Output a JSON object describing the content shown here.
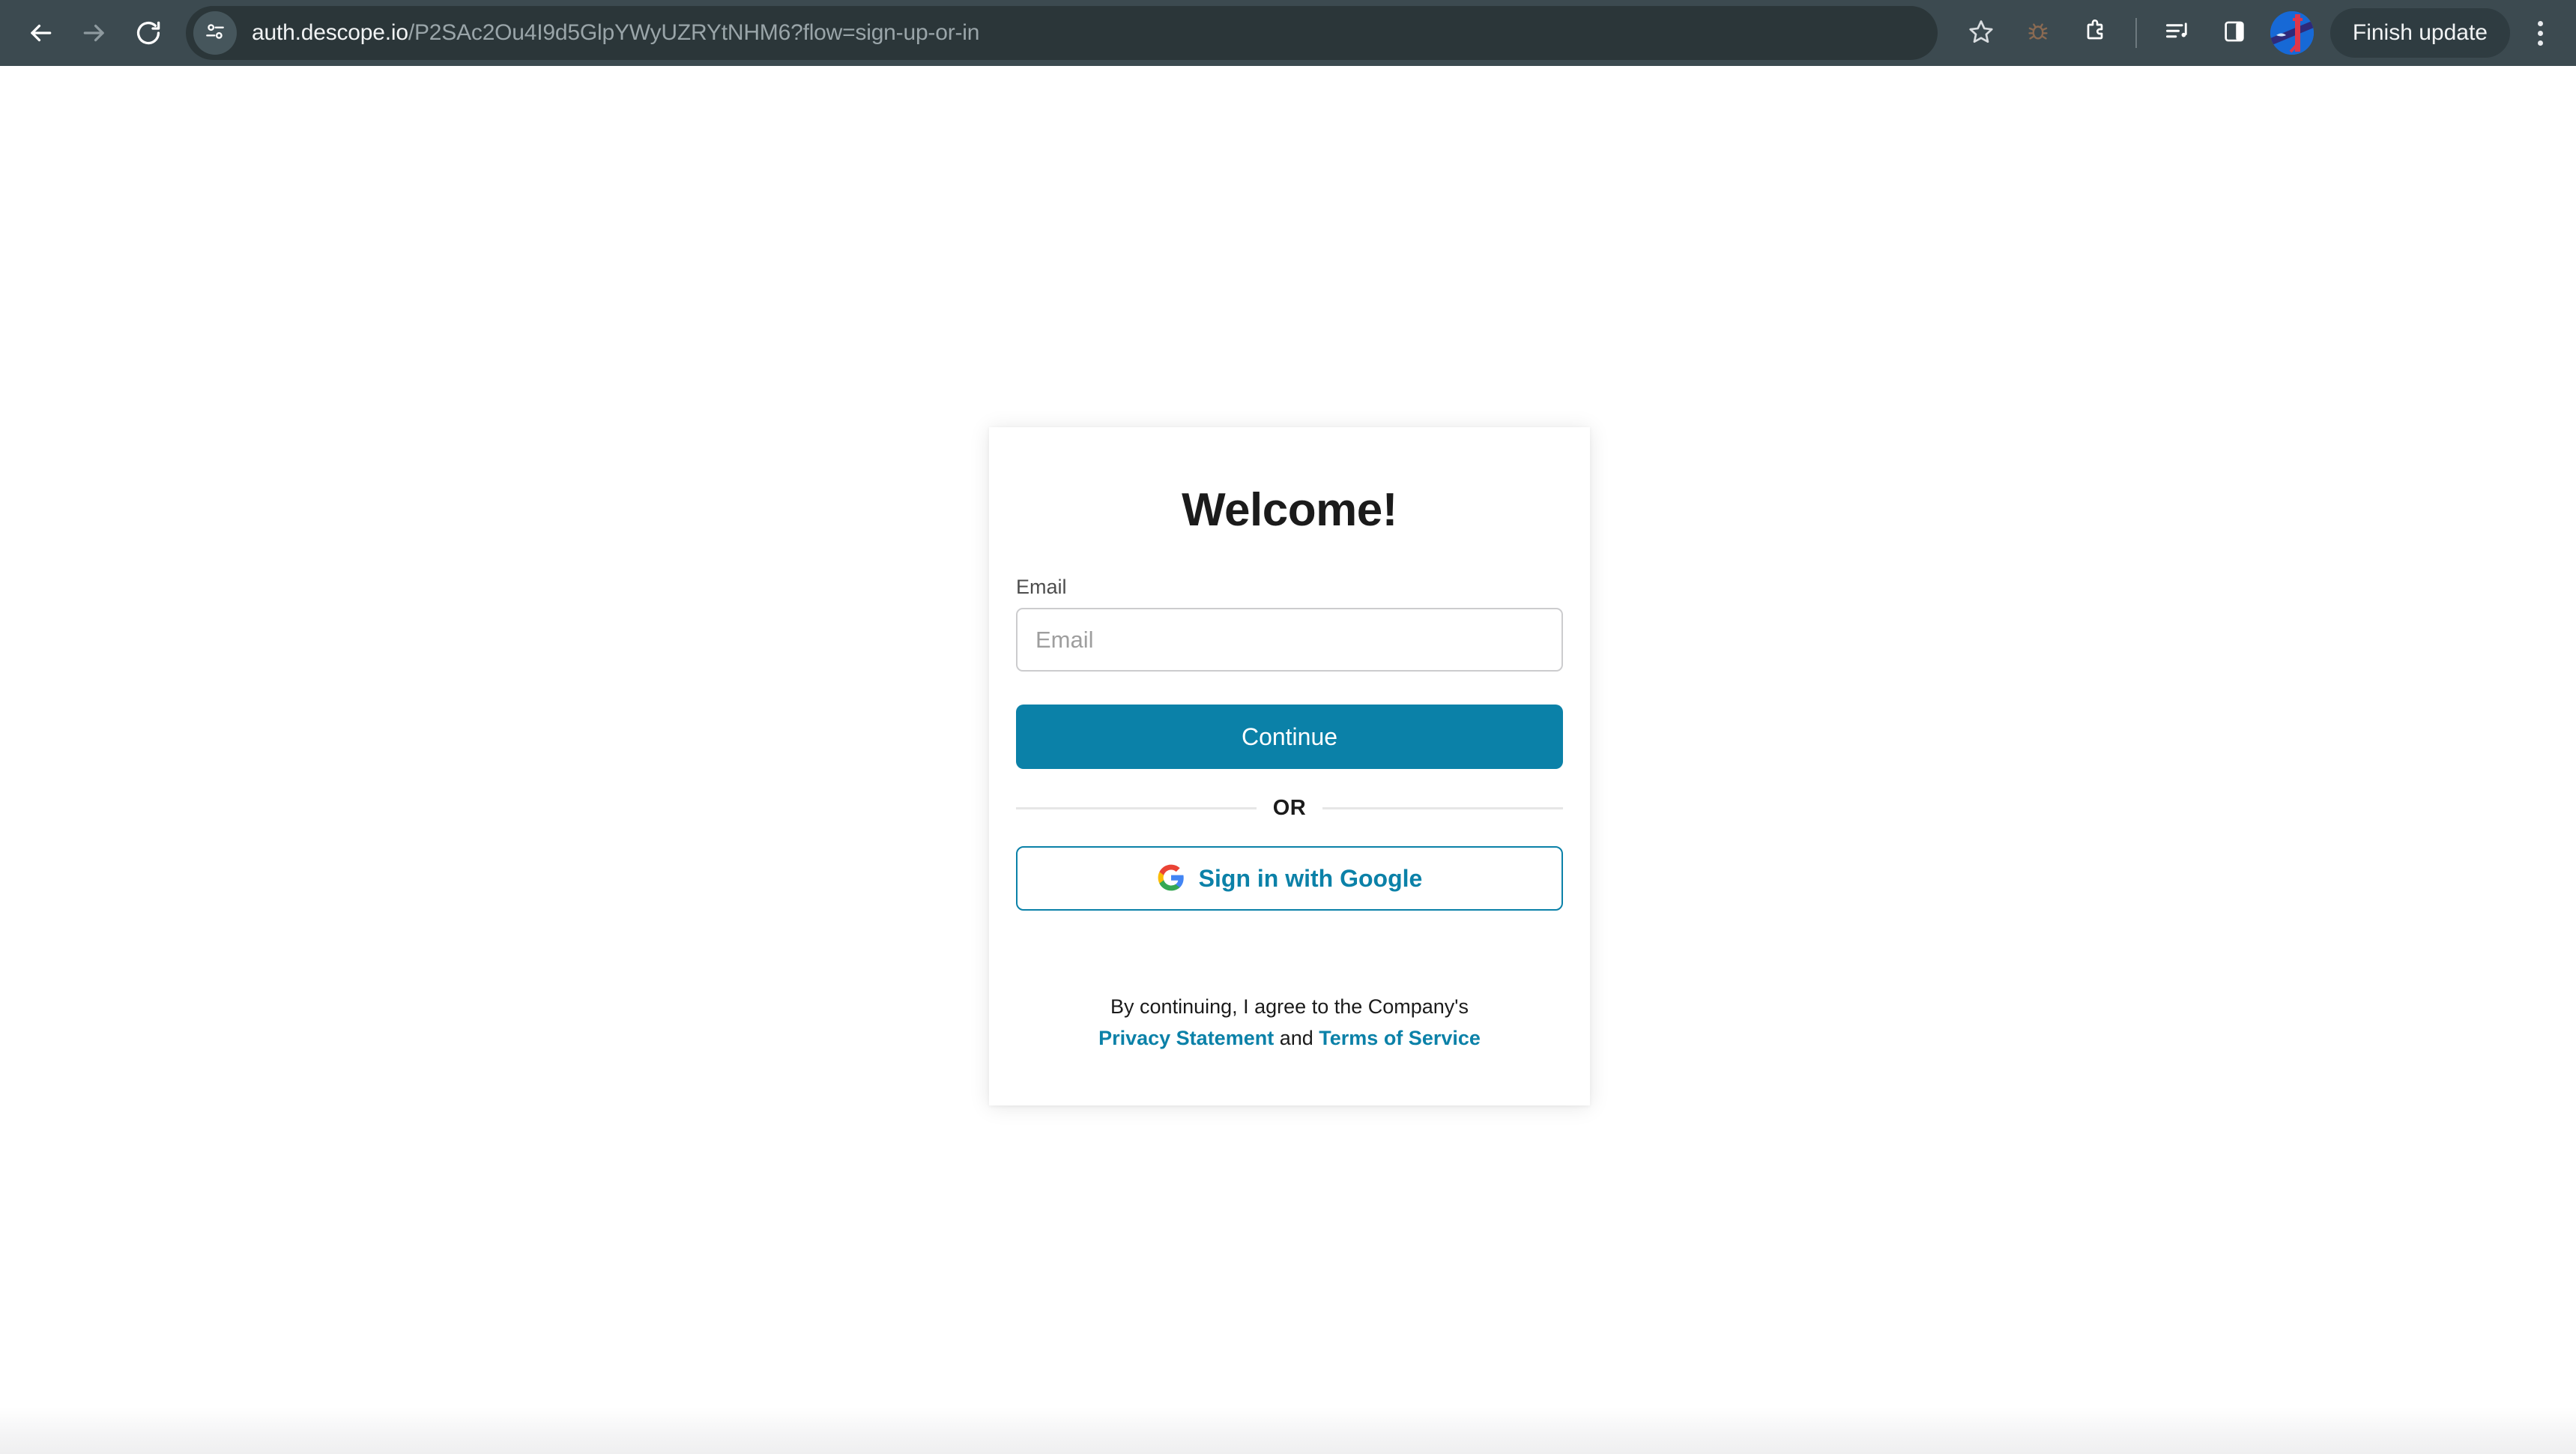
{
  "browser": {
    "nav": {
      "back_icon": "arrow-left-icon",
      "forward_icon": "arrow-right-icon",
      "reload_icon": "reload-icon"
    },
    "omnibox": {
      "site_info_icon": "site-settings-tune-icon",
      "url_host": "auth.descope.io",
      "url_path": "/P2SAc2Ou4I9d5GlpYWyUZRYtNHM6?flow=sign-up-or-in",
      "url_full": "auth.descope.io/P2SAc2Ou4I9d5GlpYWyUZRYtNHM6?flow=sign-up-or-in"
    },
    "actions": {
      "bookmark_icon": "star-icon",
      "bug_icon": "bug-icon",
      "extensions_icon": "extensions-puzzle-icon",
      "media_icon": "media-playlist-icon",
      "side_panel_icon": "side-panel-icon",
      "avatar_icon": "profile-avatar",
      "finish_update_label": "Finish update",
      "menu_icon": "three-dot-menu-icon"
    },
    "colors": {
      "toolbar_bg": "#3c4a50",
      "omnibox_bg": "#2b3639",
      "update_pill_bg": "#2f3c41"
    }
  },
  "auth": {
    "title": "Welcome!",
    "email": {
      "label": "Email",
      "placeholder": "Email",
      "value": ""
    },
    "continue_label": "Continue",
    "divider_label": "OR",
    "google": {
      "label": "Sign in with Google",
      "icon": "google-g-icon"
    },
    "legal": {
      "line1": "By continuing, I agree to the Company's",
      "privacy_label": "Privacy Statement",
      "conjunction": " and ",
      "terms_label": "Terms of Service"
    },
    "colors": {
      "accent": "#0b81a8",
      "card_bg": "#ffffff",
      "page_bg": "#ffffff",
      "input_border": "#ccccce"
    }
  }
}
